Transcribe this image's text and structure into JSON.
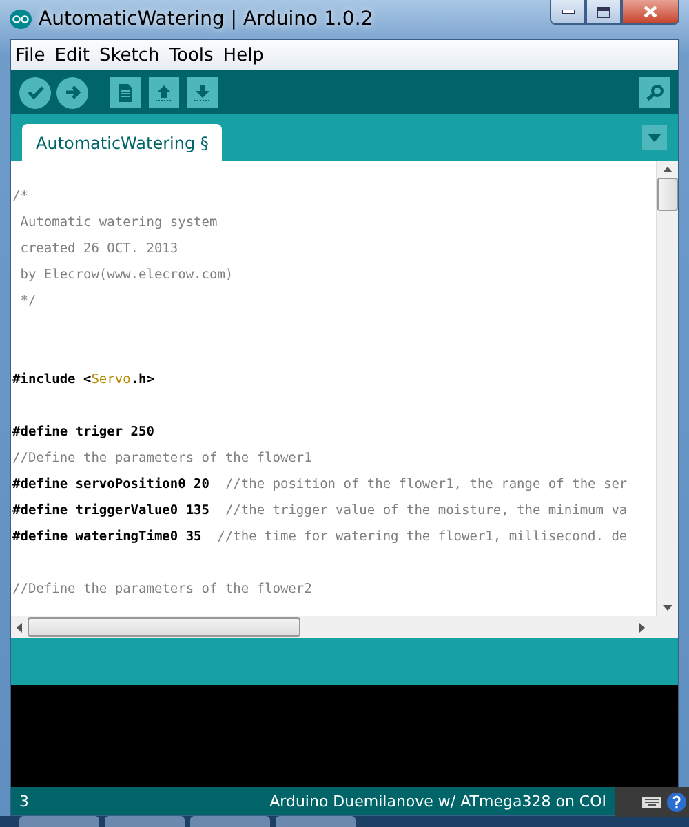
{
  "window": {
    "title": "AutomaticWatering | Arduino 1.0.2"
  },
  "menu": [
    "File",
    "Edit",
    "Sketch",
    "Tools",
    "Help"
  ],
  "toolbar": [
    {
      "kind": "verify"
    },
    {
      "kind": "upload"
    },
    {
      "kind": "new"
    },
    {
      "kind": "open"
    },
    {
      "kind": "save"
    }
  ],
  "tabs": [
    {
      "label": "AutomaticWatering §",
      "selected": true
    }
  ],
  "editor": {
    "lines": [
      {
        "kind": "text",
        "segments": [
          {
            "kind": "comment",
            "text": "/*"
          }
        ]
      },
      {
        "kind": "text",
        "segments": [
          {
            "kind": "comment",
            "text": " Automatic watering system"
          }
        ]
      },
      {
        "kind": "text",
        "segments": [
          {
            "kind": "comment",
            "text": " created 26 OCT. 2013"
          }
        ]
      },
      {
        "kind": "text",
        "segments": [
          {
            "kind": "comment",
            "text": " by Elecrow(www.elecrow.com)"
          }
        ]
      },
      {
        "kind": "text",
        "segments": [
          {
            "kind": "comment",
            "text": " */"
          }
        ]
      },
      {
        "kind": "blank"
      },
      {
        "kind": "blank"
      },
      {
        "kind": "text",
        "segments": [
          {
            "kind": "code",
            "text": "#include <"
          },
          {
            "kind": "library",
            "text": "Servo"
          },
          {
            "kind": "code",
            "text": ".h>"
          }
        ]
      },
      {
        "kind": "blank"
      },
      {
        "kind": "text",
        "segments": [
          {
            "kind": "code",
            "text": "#define triger 250"
          }
        ]
      },
      {
        "kind": "text",
        "segments": [
          {
            "kind": "comment",
            "text": "//Define the parameters of the flower1"
          }
        ]
      },
      {
        "kind": "text",
        "segments": [
          {
            "kind": "code",
            "text": "#define servoPosition0 20  "
          },
          {
            "kind": "comment",
            "text": "//the position of the flower1, the range of the ser"
          }
        ]
      },
      {
        "kind": "text",
        "segments": [
          {
            "kind": "code",
            "text": "#define triggerValue0 135  "
          },
          {
            "kind": "comment",
            "text": "//the trigger value of the moisture, the minimum va"
          }
        ]
      },
      {
        "kind": "text",
        "segments": [
          {
            "kind": "code",
            "text": "#define wateringTime0 35  "
          },
          {
            "kind": "comment",
            "text": "//the time for watering the flower1, millisecond. de"
          }
        ]
      },
      {
        "kind": "blank"
      },
      {
        "kind": "text",
        "segments": [
          {
            "kind": "comment",
            "text": "//Define the parameters of the flower2"
          }
        ]
      }
    ]
  },
  "status_bar": {
    "line": "3",
    "board": "Arduino Duemilanove w/ ATmega328 on COI"
  }
}
